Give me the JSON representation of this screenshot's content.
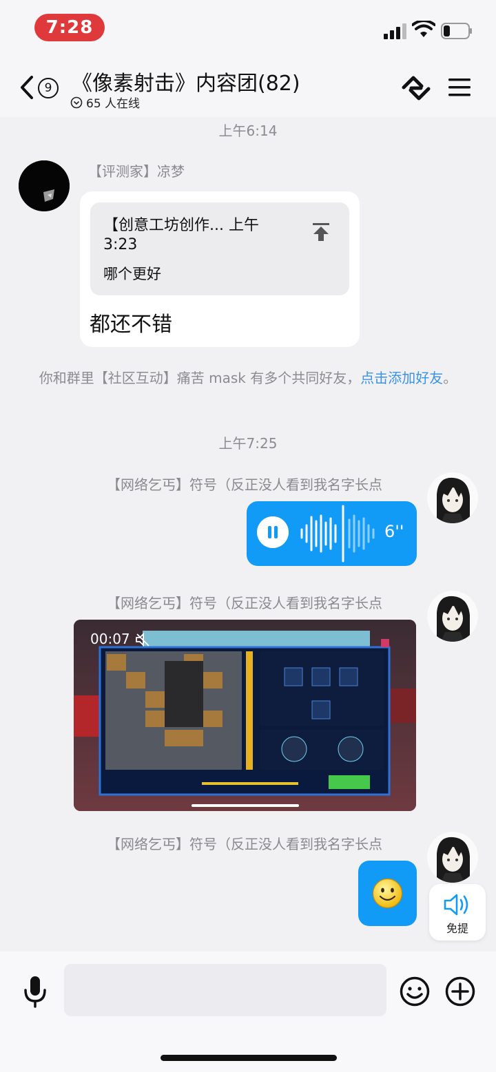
{
  "status_bar": {
    "time": "7:28"
  },
  "header": {
    "unread_count": "9",
    "title": "《像素射击》内容团(82)",
    "online_text": "65 人在线"
  },
  "messages": {
    "timestamp_1": "上午6:14",
    "received": {
      "sender": "【评测家】凉梦",
      "quote_title": "【创意工坊创作... 上午3:23",
      "quote_body": "哪个更好",
      "text": "都还不错"
    },
    "system_note": {
      "text": "你和群里【社区互动】痛苦 mask 有多个共同好友，",
      "link": "点击添加好友",
      "end": "。"
    },
    "timestamp_2": "上午7:25",
    "sent_sender_name": "【网络乞丐】符号（反正没人看到我名字长点",
    "voice_duration": "6''",
    "video_time": "00:07"
  },
  "free_mention_label": "免提",
  "input": {
    "placeholder": ""
  },
  "colors": {
    "accent": "#129bf6",
    "time_pill": "#e0393b",
    "link": "#3a93e6"
  },
  "icons": [
    "back-icon",
    "link-icon",
    "menu-icon",
    "pin-icon",
    "pause-icon",
    "mute-icon",
    "speaker-icon",
    "mic-icon",
    "emoji-icon",
    "plus-icon"
  ]
}
